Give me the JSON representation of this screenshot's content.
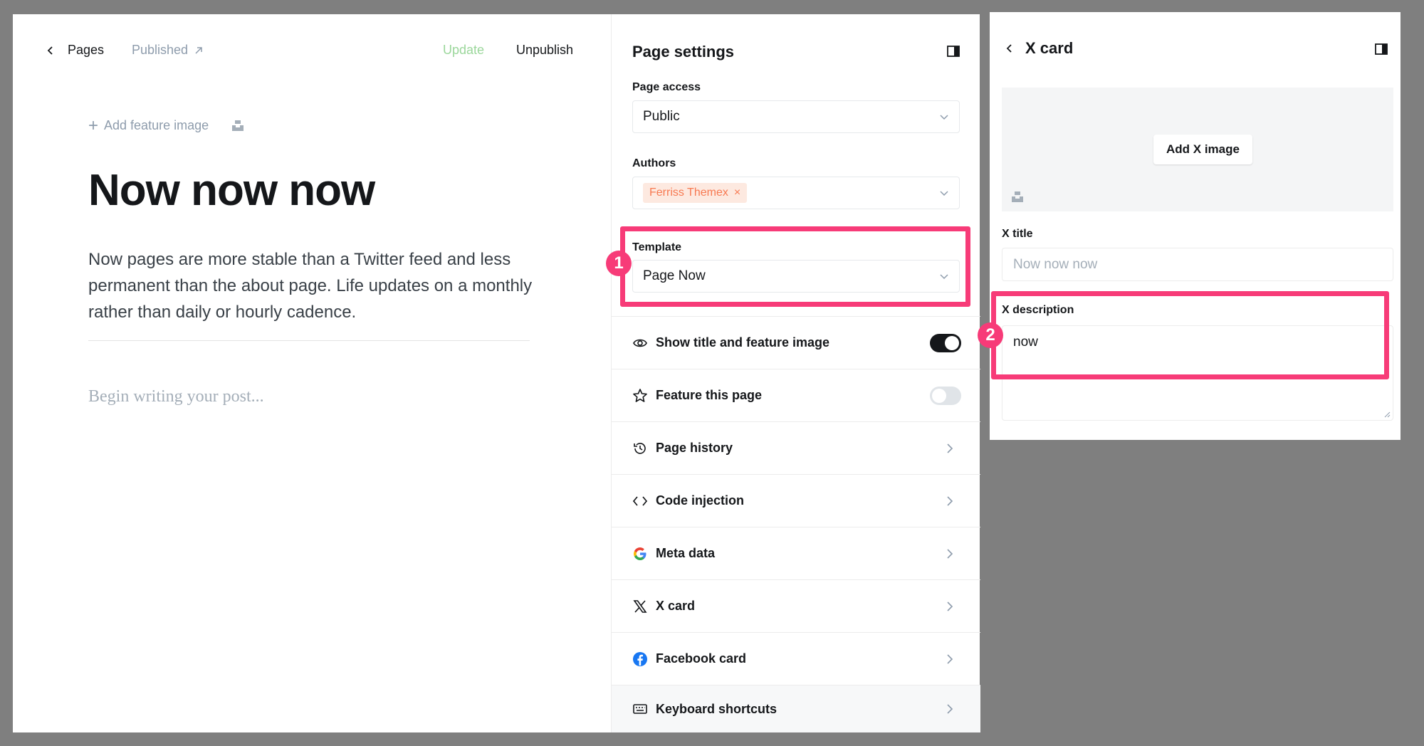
{
  "editor": {
    "breadcrumb": "Pages",
    "status": "Published",
    "update_label": "Update",
    "unpublish_label": "Unpublish",
    "add_feature_image": "Add feature image",
    "title": "Now now now",
    "excerpt": "Now pages are more stable than a Twitter feed and less permanent than the about page. Life updates on a monthly rather than daily or hourly cadence.",
    "body_placeholder": "Begin writing your post..."
  },
  "settings": {
    "title": "Page settings",
    "page_access_label": "Page access",
    "page_access_value": "Public",
    "authors_label": "Authors",
    "author_chip": "Ferriss Themex",
    "template_label": "Template",
    "template_value": "Page Now",
    "rows": [
      {
        "label": "Show title and feature image",
        "icon": "eye-icon",
        "toggle": "on"
      },
      {
        "label": "Feature this page",
        "icon": "star-icon",
        "toggle": "off"
      },
      {
        "label": "Page history",
        "icon": "history-icon"
      },
      {
        "label": "Code injection",
        "icon": "code-icon"
      },
      {
        "label": "Meta data",
        "icon": "google-icon"
      },
      {
        "label": "X card",
        "icon": "x-logo-icon"
      },
      {
        "label": "Facebook card",
        "icon": "facebook-icon"
      },
      {
        "label": "Keyboard shortcuts",
        "icon": "keyboard-icon"
      }
    ]
  },
  "xcard": {
    "title": "X card",
    "add_image_label": "Add X image",
    "x_title_label": "X title",
    "x_title_placeholder": "Now now now",
    "x_description_label": "X description",
    "x_description_value": "now"
  },
  "markers": [
    "1",
    "2"
  ],
  "colors": {
    "highlight": "#f73b78",
    "update_green": "#9bd79b",
    "author_chip_bg": "#fde9e0",
    "author_chip_text": "#f77951"
  }
}
